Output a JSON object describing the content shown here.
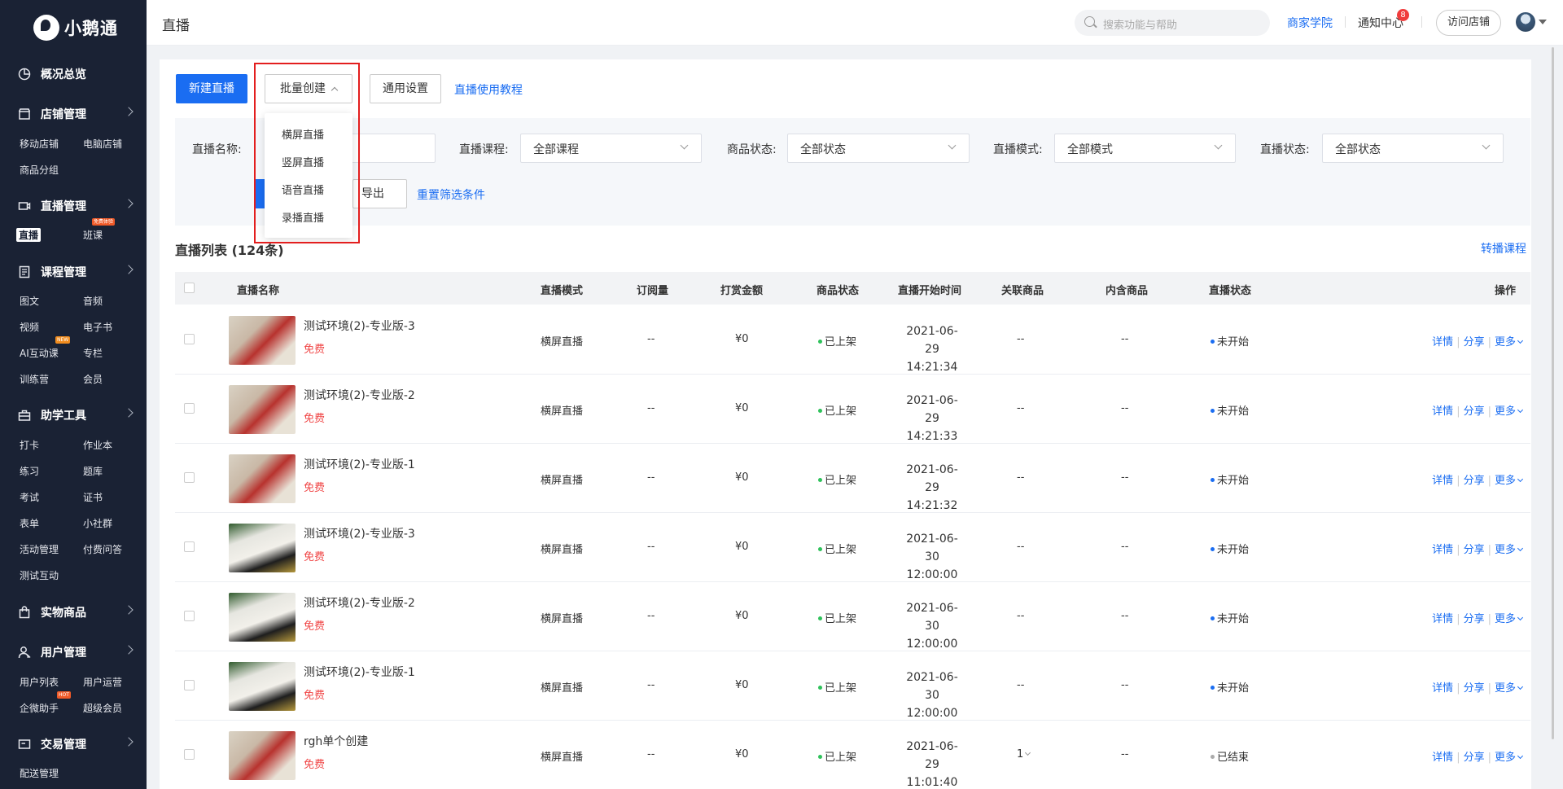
{
  "brand": {
    "name": "小鹅通"
  },
  "sidebar": {
    "sections": [
      {
        "label": "概况总览",
        "icon": "pie-chart-icon",
        "chevron": false
      },
      {
        "label": "店铺管理",
        "icon": "store-icon",
        "chevron": true
      },
      {
        "label": "直播管理",
        "icon": "live-camera-icon",
        "chevron": true
      },
      {
        "label": "课程管理",
        "icon": "document-list-icon",
        "chevron": true
      },
      {
        "label": "助学工具",
        "icon": "toolbox-icon",
        "chevron": true
      },
      {
        "label": "实物商品",
        "icon": "shopping-bag-icon",
        "chevron": true
      },
      {
        "label": "用户管理",
        "icon": "user-icon",
        "chevron": true
      },
      {
        "label": "交易管理",
        "icon": "wallet-icon",
        "chevron": true
      }
    ],
    "items": [
      "移动店铺",
      "电脑店铺",
      "商品分组",
      "直播",
      "班课",
      "图文",
      "音频",
      "视频",
      "电子书",
      "AI互动课",
      "专栏",
      "训练营",
      "会员",
      "打卡",
      "作业本",
      "练习",
      "题库",
      "考试",
      "证书",
      "表单",
      "小社群",
      "活动管理",
      "付费问答",
      "测试互动",
      "用户列表",
      "用户运营",
      "企微助手",
      "超级会员",
      "配送管理"
    ],
    "tags": {
      "banke": "免费体验",
      "ai": "NEW",
      "qiwei": "HOT"
    },
    "tag_colors": {
      "banke": "#f05a28",
      "ai": "#f08c1e",
      "qiwei": "#f05a28"
    }
  },
  "header": {
    "title": "直播",
    "search_placeholder": "搜索功能与帮助",
    "academy": "商家学院",
    "notify": "通知中心",
    "notify_count": "8",
    "visit_store": "访问店铺"
  },
  "toolbar": {
    "new_live": "新建直播",
    "batch_create": "批量创建",
    "general_settings": "通用设置",
    "tutorial": "直播使用教程"
  },
  "batch_menu": [
    "横屏直播",
    "竖屏直播",
    "语音直播",
    "录播直播"
  ],
  "filters": {
    "name_label": "直播名称:",
    "course_label": "直播课程:",
    "course_value": "全部课程",
    "goods_status_label": "商品状态:",
    "goods_status_value": "全部状态",
    "mode_label": "直播模式:",
    "mode_value": "全部模式",
    "live_status_label": "直播状态:",
    "live_status_value": "全部状态",
    "export": "导出",
    "reset": "重置筛选条件"
  },
  "list": {
    "title": "直播列表 (124条)",
    "transfer_link": "转播课程",
    "columns": [
      "直播名称",
      "直播模式",
      "订阅量",
      "打赏金额",
      "商品状态",
      "直播开始时间",
      "关联商品",
      "内含商品",
      "直播状态",
      "操作"
    ],
    "ops": [
      "详情",
      "分享",
      "更多"
    ],
    "rows": [
      {
        "name": "测试环境(2)-专业版-3",
        "price": "免费",
        "mode": "横屏直播",
        "subs": "--",
        "reward": "¥0",
        "goods_status": "已上架",
        "date": "2021-06-29",
        "time": "14:21:34",
        "linked": "--",
        "contained": "--",
        "status": "未开始",
        "thumb": "t1"
      },
      {
        "name": "测试环境(2)-专业版-2",
        "price": "免费",
        "mode": "横屏直播",
        "subs": "--",
        "reward": "¥0",
        "goods_status": "已上架",
        "date": "2021-06-29",
        "time": "14:21:33",
        "linked": "--",
        "contained": "--",
        "status": "未开始",
        "thumb": "t1"
      },
      {
        "name": "测试环境(2)-专业版-1",
        "price": "免费",
        "mode": "横屏直播",
        "subs": "--",
        "reward": "¥0",
        "goods_status": "已上架",
        "date": "2021-06-29",
        "time": "14:21:32",
        "linked": "--",
        "contained": "--",
        "status": "未开始",
        "thumb": "t1"
      },
      {
        "name": "测试环境(2)-专业版-3",
        "price": "免费",
        "mode": "横屏直播",
        "subs": "--",
        "reward": "¥0",
        "goods_status": "已上架",
        "date": "2021-06-30",
        "time": "12:00:00",
        "linked": "--",
        "contained": "--",
        "status": "未开始",
        "thumb": "t2"
      },
      {
        "name": "测试环境(2)-专业版-2",
        "price": "免费",
        "mode": "横屏直播",
        "subs": "--",
        "reward": "¥0",
        "goods_status": "已上架",
        "date": "2021-06-30",
        "time": "12:00:00",
        "linked": "--",
        "contained": "--",
        "status": "未开始",
        "thumb": "t2"
      },
      {
        "name": "测试环境(2)-专业版-1",
        "price": "免费",
        "mode": "横屏直播",
        "subs": "--",
        "reward": "¥0",
        "goods_status": "已上架",
        "date": "2021-06-30",
        "time": "12:00:00",
        "linked": "--",
        "contained": "--",
        "status": "未开始",
        "thumb": "t2"
      },
      {
        "name": "rgh单个创建",
        "price": "免费",
        "mode": "横屏直播",
        "subs": "--",
        "reward": "¥0",
        "goods_status": "已上架",
        "date": "2021-06-29",
        "time": "11:01:40",
        "linked": "1",
        "contained": "--",
        "status": "已结束",
        "thumb": "t1"
      }
    ]
  },
  "colors": {
    "accent": "#1a6df2",
    "sidebar_bg": "#1a2234",
    "on_sale": "#2fc25b",
    "not_started": "#1a6df2",
    "ended": "#aaaaaa",
    "free": "#f04646",
    "highlight": "#e31e1e"
  }
}
